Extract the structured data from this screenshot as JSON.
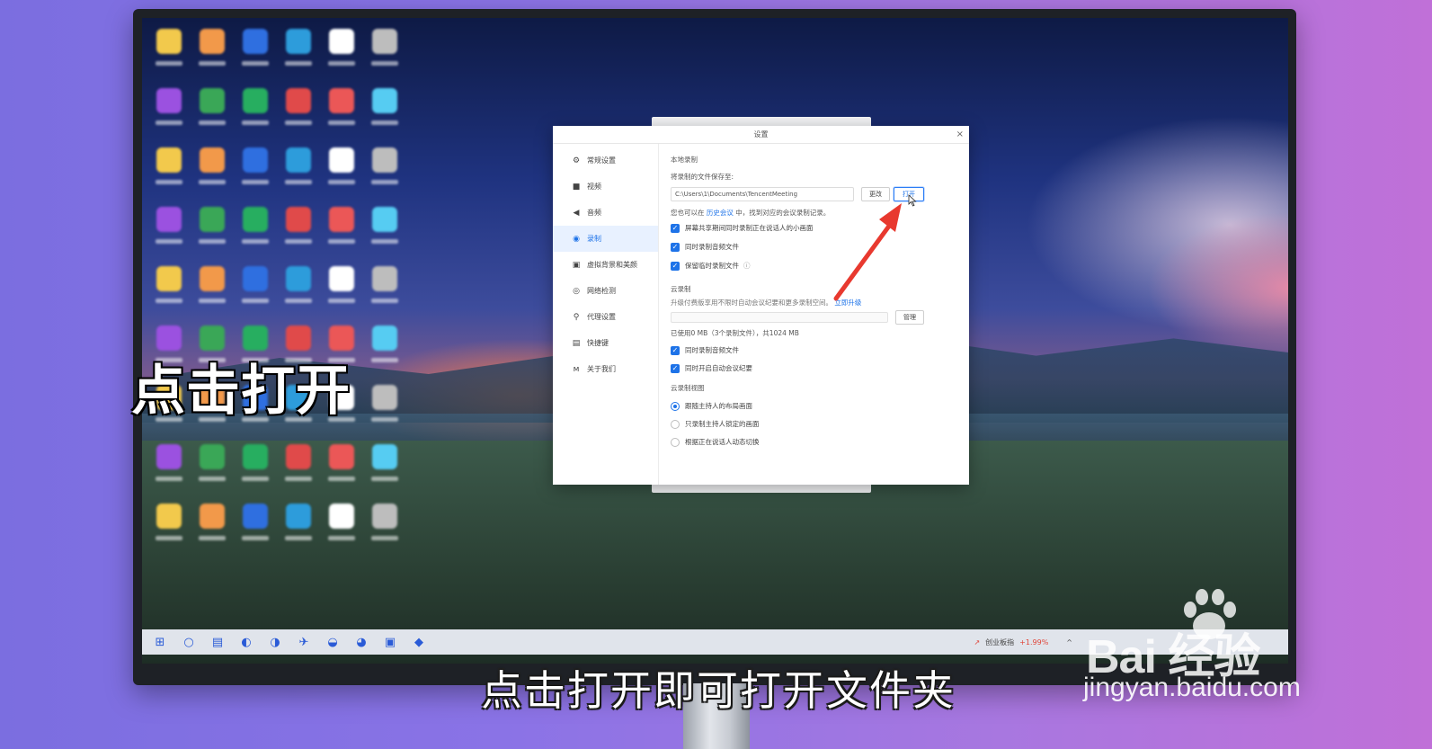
{
  "dialog": {
    "title": "设置",
    "close": "×",
    "sidebar": [
      {
        "label": "常规设置",
        "icon": "⚙",
        "icon_name": "gear-icon"
      },
      {
        "label": "视频",
        "icon": "■",
        "icon_name": "camera-icon"
      },
      {
        "label": "音频",
        "icon": "◀",
        "icon_name": "speaker-icon"
      },
      {
        "label": "录制",
        "icon": "◉",
        "icon_name": "record-icon"
      },
      {
        "label": "虚拟背景和美颜",
        "icon": "▣",
        "icon_name": "portrait-icon"
      },
      {
        "label": "网络检测",
        "icon": "◎",
        "icon_name": "globe-icon"
      },
      {
        "label": "代理设置",
        "icon": "⚲",
        "icon_name": "proxy-icon"
      },
      {
        "label": "快捷键",
        "icon": "▤",
        "icon_name": "keyboard-icon"
      },
      {
        "label": "关于我们",
        "icon": "ᴍ",
        "icon_name": "logo-icon"
      }
    ],
    "active_index": 3,
    "local": {
      "title": "本地录制",
      "save_label": "将录制的文件保存至:",
      "path": "C:\\Users\\1\\Documents\\TencentMeeting",
      "change_button": "更改",
      "open_button": "打开",
      "history_prefix": "您也可以在",
      "history_link": "历史会议",
      "history_suffix": "中，找到对应的会议录制记录。",
      "options": [
        "屏幕共享期间同时录制正在说话人的小画面",
        "同时录制音频文件",
        "保留临时录制文件"
      ],
      "info_icon": "ⓘ"
    },
    "cloud": {
      "title": "云录制",
      "upgrade_text": "升级付费版享用不限时自动会议纪要和更多录制空间。",
      "upgrade_link": "立即升级",
      "manage_button": "管理",
      "usage": "已使用0 MB（3个录制文件），共1024 MB",
      "options": [
        "同时录制音频文件",
        "同时开启自动会议纪要"
      ]
    },
    "cloud_view": {
      "title": "云录制视图",
      "options": [
        "跟随主持人的布局画面",
        "只录制主持人锁定的画面",
        "根据正在说话人动态切换"
      ],
      "selected_index": 0
    }
  },
  "taskbar": {
    "icons": [
      "⊞",
      "○",
      "▤",
      "◐",
      "◑",
      "✈",
      "◒",
      "◕",
      "▣",
      "◆"
    ],
    "stock_name": "创业板指",
    "stock_change": "+1.99%",
    "tray": "^"
  },
  "captions": {
    "left": "点击打开",
    "bottom": "点击打开即可打开文件夹"
  },
  "watermark": {
    "logo": "Bai  经验",
    "url": "jingyan.baidu.com"
  },
  "colors": {
    "accent": "#1e73e8",
    "arrow": "#e8392f"
  }
}
